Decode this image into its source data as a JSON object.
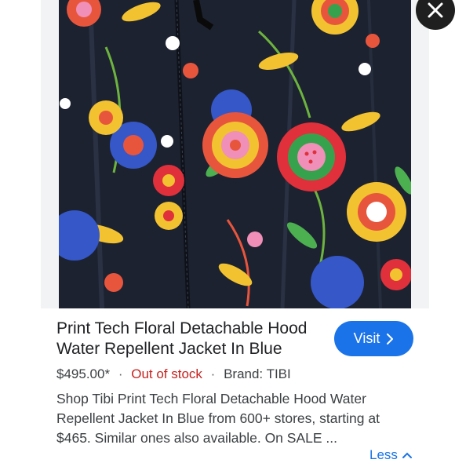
{
  "product": {
    "title": "Print Tech Floral Detachable Hood Water Repellent Jacket In Blue",
    "price": "$495.00*",
    "separator": "·",
    "stock_status": "Out of stock",
    "brand": "Brand: TIBI",
    "description": "Shop Tibi Print Tech Floral Detachable Hood Water Repellent Jacket In Blue from 600+ stores, starting at $465. Similar ones also available. On SALE ...",
    "visit_label": "Visit",
    "less_label": "Less"
  },
  "icons": {
    "close": "close-icon",
    "visit": "chevron-right-icon",
    "less": "chevron-up-icon"
  },
  "colors": {
    "accent": "#1a73e8",
    "out_of_stock": "#c5221f",
    "jacket_background": "#1c2230"
  }
}
